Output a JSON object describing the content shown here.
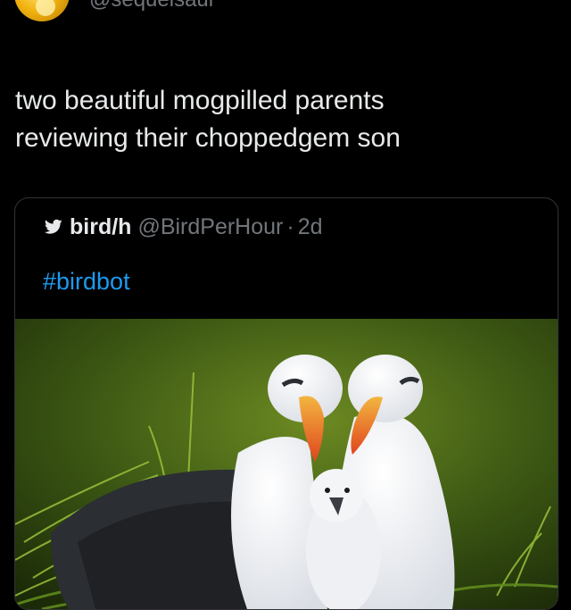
{
  "author": {
    "handle": "@sequelsaur",
    "avatar_icon": "gold-coin-avatar"
  },
  "tweet": {
    "lines": [
      "two beautiful mogpilled parents",
      "reviewing their choppedgem son"
    ]
  },
  "quoted_tweet": {
    "icon": "bird-icon",
    "name": "bird/h",
    "handle": "@BirdPerHour",
    "separator": "·",
    "time": "2d",
    "hashtag": "#birdbot"
  },
  "colors": {
    "background": "#000000",
    "text": "#e7e9ea",
    "muted": "#71767b",
    "link": "#1d9bf0",
    "border": "#2f3336"
  }
}
